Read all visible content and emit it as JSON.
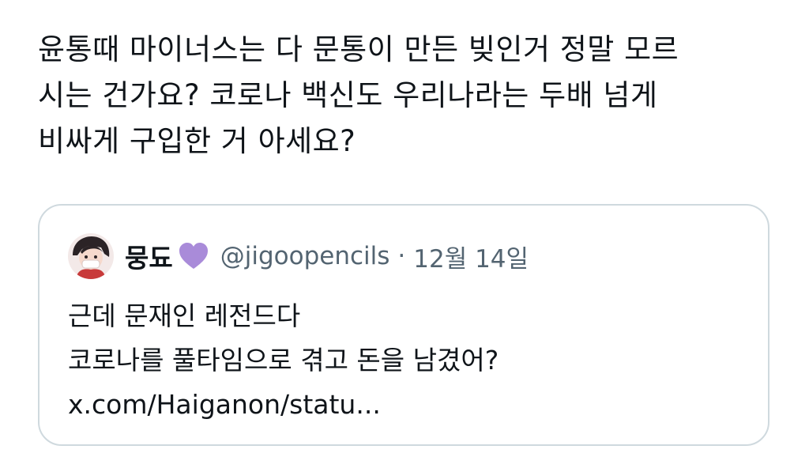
{
  "tweet": {
    "text_lines": [
      "윤통때 마이너스는 다 문통이 만든 빚인거 정말 모르",
      "시는 건가요? 코로나 백신도 우리나라는 두배 넘게",
      "비싸게 구입한 거 아세요?"
    ]
  },
  "quote": {
    "display_name": "뭉됴",
    "emoji": "purple-heart-icon",
    "handle": "@jigoopencils",
    "separator": "·",
    "date": "12월 14일",
    "text_lines": [
      "근데 문재인 레전드다",
      "코로나를 풀타임으로 겪고 돈을 남겼어?",
      "x.com/Haiganon/statu..."
    ]
  },
  "colors": {
    "text": "#0f1419",
    "muted": "#536471",
    "border": "#cfd9de",
    "heart": "#a98bd9"
  }
}
